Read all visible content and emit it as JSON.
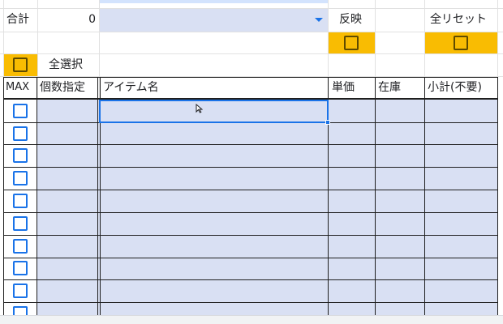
{
  "summary": {
    "total_label": "合計",
    "total_value": "0",
    "apply_label": "反映",
    "reset_label": "全リセット",
    "select_all_label": "全選択"
  },
  "table": {
    "headers": [
      "MAX",
      "個数指定",
      "アイテム名",
      "単価",
      "在庫",
      "小計(不要)"
    ]
  },
  "colors": {
    "accent_blue": "#1a73e8",
    "row_fill": "#d9e0f3",
    "checkbox_cell_fill": "#f9bc02",
    "grid_dark": "#1f1f1f"
  },
  "icons": [
    "dropdown-arrow-icon",
    "cursor-icon"
  ]
}
